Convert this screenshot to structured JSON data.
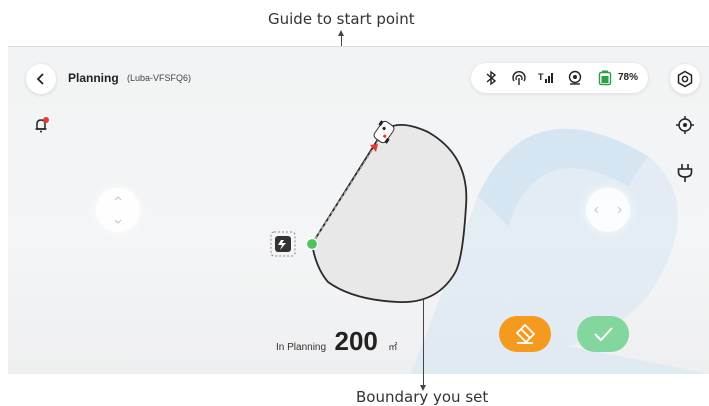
{
  "annotations": {
    "top": "Guide to start point",
    "bottom": "Boundary you set"
  },
  "header": {
    "title": "Planning",
    "subtitle": "(Luba-VFSFQ6)"
  },
  "status": {
    "battery": "78%",
    "icons": [
      "bluetooth-icon",
      "wifi-icon",
      "cellular-signal-icon",
      "gps-icon",
      "battery-icon"
    ]
  },
  "side_buttons": {
    "left": [
      "back-icon",
      "alert-bell-icon"
    ],
    "right": [
      "settings-icon",
      "target-icon",
      "plug-icon"
    ]
  },
  "planning": {
    "label": "In Planning",
    "value": "200",
    "unit": "㎡"
  },
  "actions": {
    "eraser": "eraser-icon",
    "confirm": "check-icon"
  },
  "colors": {
    "accent_orange": "#f39a1f",
    "accent_green": "#83d69e",
    "start_point": "#4cc35a",
    "alert_dot": "#e53935"
  }
}
